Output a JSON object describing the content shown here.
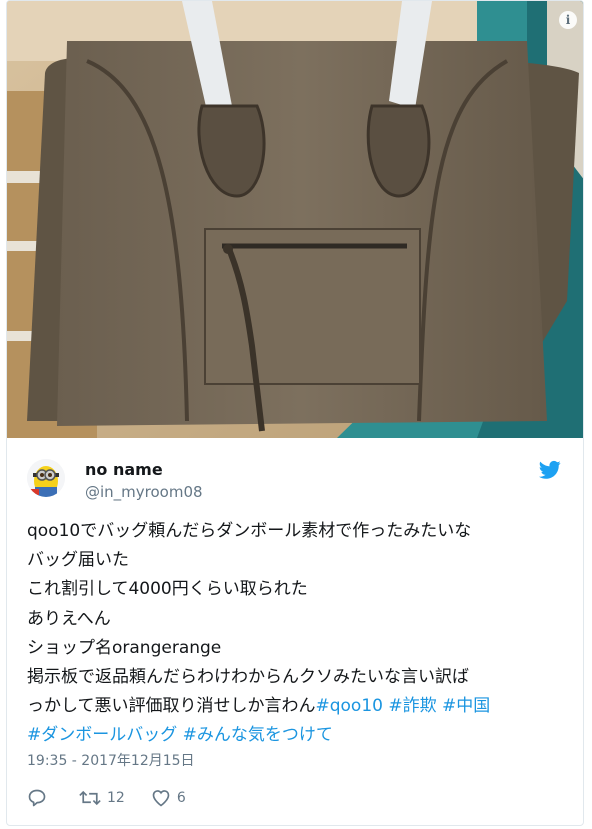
{
  "photo": {
    "alt": "",
    "info_icon": "info-icon"
  },
  "tweet": {
    "author_name": "no name",
    "author_handle": "@in_myroom08",
    "avatar_icon": "minion-avatar",
    "brand_icon": "twitter-bird-icon",
    "lines": [
      "qoo10でバッグ頼んだらダンボール素材で作ったみたいな",
      "バッグ届いた",
      "これ割引して4000円くらい取られた",
      "ありえへん",
      "ショップ名orangerange",
      "掲示板で返品頼んだらわけわからんクソみたいな言い訳ば",
      "っかして悪い評価取り消せしか言わん"
    ],
    "hashtags_line7": [
      "#qoo10",
      "#詐欺",
      "#中国"
    ],
    "hashtags_line8": [
      "#ダンボールバッグ",
      "#みんな気をつけて"
    ],
    "timestamp": "19:35 - 2017年12月15日",
    "reply_count": "",
    "retweet_count": "12",
    "like_count": "6"
  },
  "colors": {
    "link": "#1b95e0",
    "secondary_text": "#657786",
    "brand": "#1da1f2"
  }
}
